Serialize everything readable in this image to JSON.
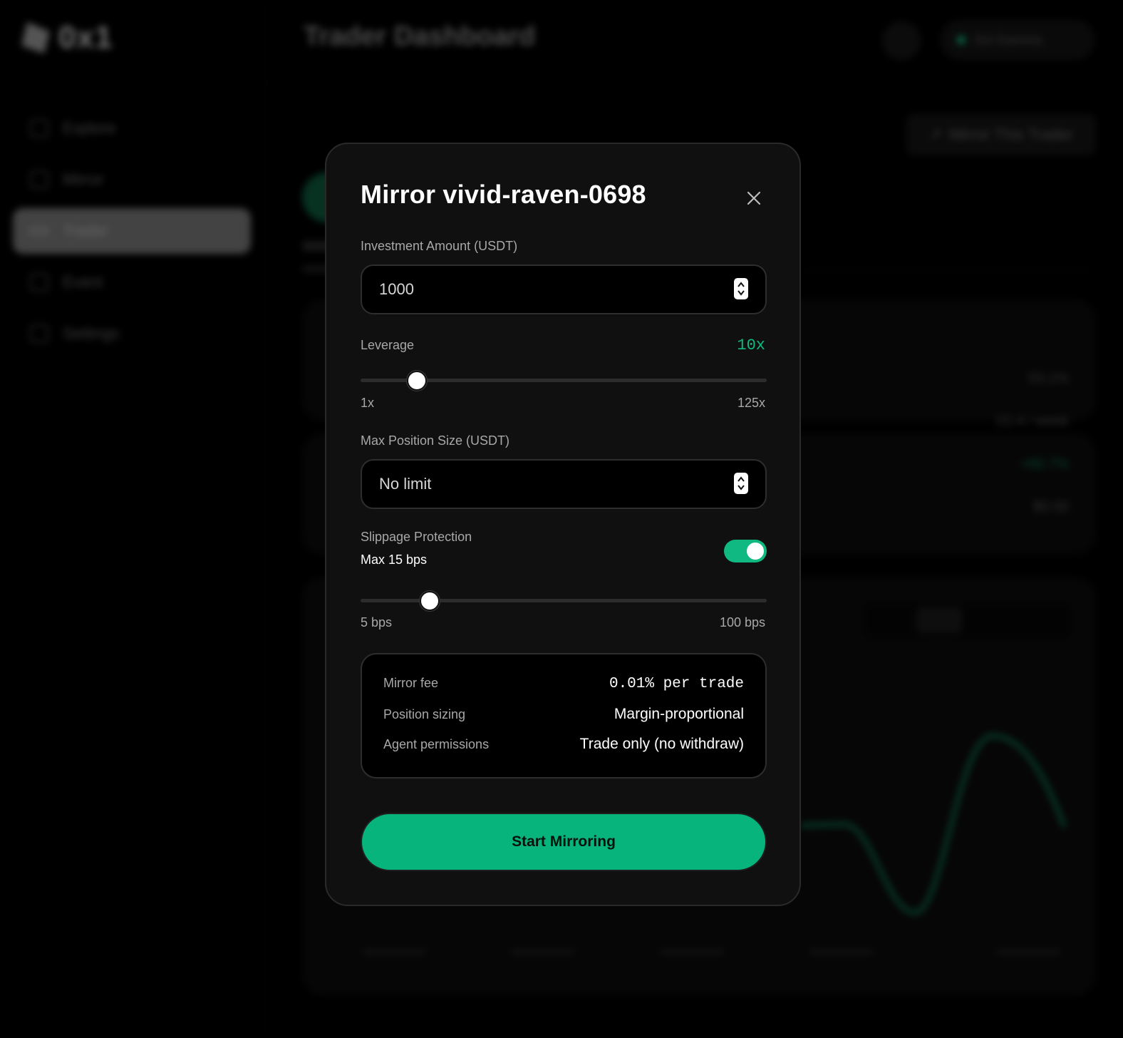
{
  "background": {
    "logo_text": "0x1",
    "page_title": "Trader Dashboard",
    "nav": [
      {
        "label": "Explore"
      },
      {
        "label": "Mirror"
      },
      {
        "label": "Trader"
      },
      {
        "label": "Event"
      },
      {
        "label": "Settings"
      }
    ],
    "account_label": "Sol Gamma",
    "mirror_button_label": "Mirror This Trader",
    "stats": [
      "53.1%",
      "22.4 / week",
      "+80.7%",
      "$0.00"
    ],
    "timeframes": [
      "7D",
      "30D",
      "90D",
      "All"
    ]
  },
  "modal": {
    "title": "Mirror vivid-raven-0698",
    "investment": {
      "label": "Investment Amount (USDT)",
      "value": "1000"
    },
    "leverage": {
      "label": "Leverage",
      "value_text": "10x",
      "value": 10,
      "min": 1,
      "max": 125,
      "min_label": "1x",
      "max_label": "125x"
    },
    "max_position": {
      "label": "Max Position Size (USDT)",
      "placeholder": "No limit"
    },
    "slippage": {
      "label": "Slippage Protection",
      "subtitle": "Max 15 bps",
      "enabled": true,
      "value": 15,
      "min": 5,
      "max": 100,
      "min_label": "5 bps",
      "max_label": "100 bps"
    },
    "info": [
      {
        "key": "Mirror fee",
        "value": "0.01% per trade"
      },
      {
        "key": "Position sizing",
        "value": "Margin-proportional"
      },
      {
        "key": "Agent permissions",
        "value": "Trade only (no withdraw)"
      }
    ],
    "start_button_label": "Start Mirroring"
  },
  "colors": {
    "accent": "#10b981",
    "button": "#07b47c",
    "modal_bg": "#101010",
    "input_bg": "#000000"
  }
}
